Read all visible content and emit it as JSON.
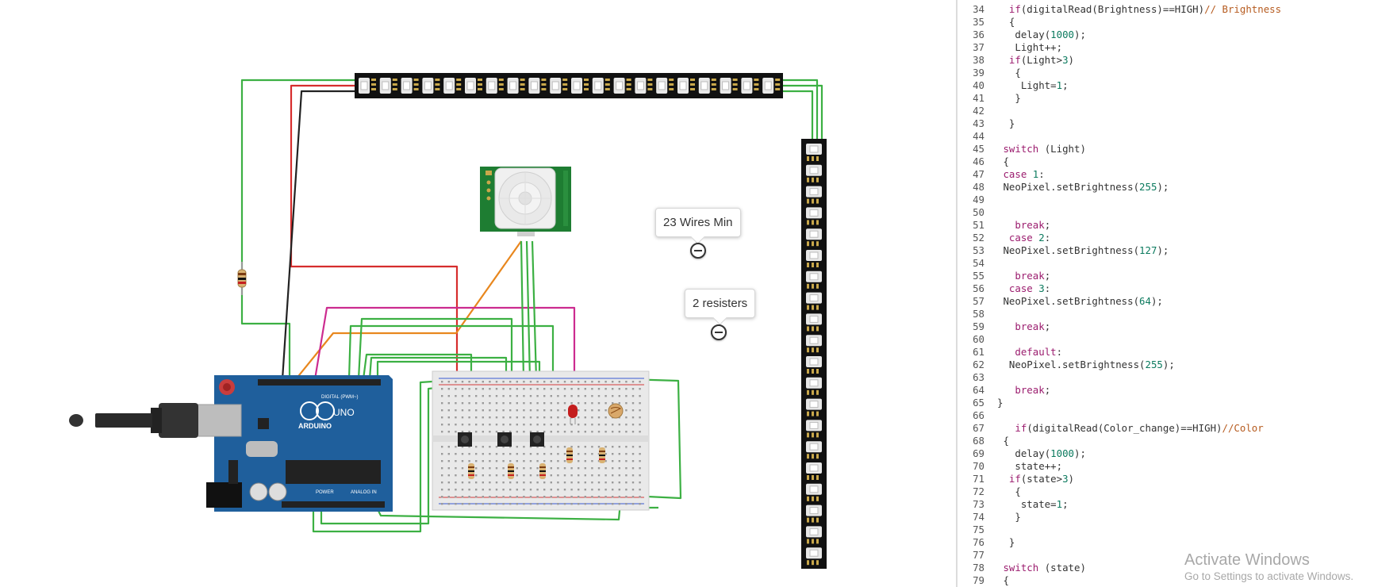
{
  "annotations": [
    {
      "text": "23 Wires Min"
    },
    {
      "text": "2 resisters"
    }
  ],
  "arduino": {
    "brand": "ARDUINO",
    "model": "UNO",
    "digital_label": "DIGITAL (PWM~)",
    "power_label": "POWER",
    "analog_label": "ANALOG IN"
  },
  "code_lines": [
    {
      "n": "34",
      "t": [
        [
          "ind",
          "  "
        ],
        [
          "kw",
          "if"
        ],
        [
          "fn",
          "(digitalRead(Brightness)==HIGH)"
        ],
        [
          "cm",
          "// Brightness"
        ]
      ]
    },
    {
      "n": "35",
      "t": [
        [
          "ind",
          "  "
        ],
        [
          "fn",
          "{"
        ]
      ]
    },
    {
      "n": "36",
      "t": [
        [
          "ind",
          "   "
        ],
        [
          "fn",
          "delay("
        ],
        [
          "num",
          "1000"
        ],
        [
          "fn",
          ");"
        ]
      ]
    },
    {
      "n": "37",
      "t": [
        [
          "ind",
          "   "
        ],
        [
          "fn",
          "Light++;"
        ]
      ]
    },
    {
      "n": "38",
      "t": [
        [
          "ind",
          "  "
        ],
        [
          "kw",
          "if"
        ],
        [
          "fn",
          "(Light>"
        ],
        [
          "num",
          "3"
        ],
        [
          "fn",
          ")"
        ]
      ]
    },
    {
      "n": "39",
      "t": [
        [
          "ind",
          "   "
        ],
        [
          "fn",
          "{"
        ]
      ]
    },
    {
      "n": "40",
      "t": [
        [
          "ind",
          "    "
        ],
        [
          "fn",
          "Light="
        ],
        [
          "num",
          "1"
        ],
        [
          "fn",
          ";"
        ]
      ]
    },
    {
      "n": "41",
      "t": [
        [
          "ind",
          "   "
        ],
        [
          "fn",
          "}"
        ]
      ]
    },
    {
      "n": "42",
      "t": []
    },
    {
      "n": "43",
      "t": [
        [
          "ind",
          "  "
        ],
        [
          "fn",
          "}"
        ]
      ]
    },
    {
      "n": "44",
      "t": []
    },
    {
      "n": "45",
      "t": [
        [
          "ind",
          " "
        ],
        [
          "kw",
          "switch"
        ],
        [
          "fn",
          " (Light)"
        ]
      ]
    },
    {
      "n": "46",
      "t": [
        [
          "ind",
          " "
        ],
        [
          "fn",
          "{"
        ]
      ]
    },
    {
      "n": "47",
      "t": [
        [
          "ind",
          " "
        ],
        [
          "kw",
          "case"
        ],
        [
          "fn",
          " "
        ],
        [
          "num",
          "1"
        ],
        [
          "fn",
          ":"
        ]
      ]
    },
    {
      "n": "48",
      "t": [
        [
          "ind",
          " "
        ],
        [
          "fn",
          "NeoPixel.setBrightness("
        ],
        [
          "num",
          "255"
        ],
        [
          "fn",
          ");"
        ]
      ]
    },
    {
      "n": "49",
      "t": []
    },
    {
      "n": "50",
      "t": []
    },
    {
      "n": "51",
      "t": [
        [
          "ind",
          "   "
        ],
        [
          "kw",
          "break"
        ],
        [
          "fn",
          ";"
        ]
      ]
    },
    {
      "n": "52",
      "t": [
        [
          "ind",
          "  "
        ],
        [
          "kw",
          "case"
        ],
        [
          "fn",
          " "
        ],
        [
          "num",
          "2"
        ],
        [
          "fn",
          ":"
        ]
      ]
    },
    {
      "n": "53",
      "t": [
        [
          "ind",
          " "
        ],
        [
          "fn",
          "NeoPixel.setBrightness("
        ],
        [
          "num",
          "127"
        ],
        [
          "fn",
          ");"
        ]
      ]
    },
    {
      "n": "54",
      "t": []
    },
    {
      "n": "55",
      "t": [
        [
          "ind",
          "   "
        ],
        [
          "kw",
          "break"
        ],
        [
          "fn",
          ";"
        ]
      ]
    },
    {
      "n": "56",
      "t": [
        [
          "ind",
          "  "
        ],
        [
          "kw",
          "case"
        ],
        [
          "fn",
          " "
        ],
        [
          "num",
          "3"
        ],
        [
          "fn",
          ":"
        ]
      ]
    },
    {
      "n": "57",
      "t": [
        [
          "ind",
          " "
        ],
        [
          "fn",
          "NeoPixel.setBrightness("
        ],
        [
          "num",
          "64"
        ],
        [
          "fn",
          ");"
        ]
      ]
    },
    {
      "n": "58",
      "t": []
    },
    {
      "n": "59",
      "t": [
        [
          "ind",
          "   "
        ],
        [
          "kw",
          "break"
        ],
        [
          "fn",
          ";"
        ]
      ]
    },
    {
      "n": "60",
      "t": []
    },
    {
      "n": "61",
      "t": [
        [
          "ind",
          "   "
        ],
        [
          "kw",
          "default"
        ],
        [
          "fn",
          ":"
        ]
      ]
    },
    {
      "n": "62",
      "t": [
        [
          "ind",
          "  "
        ],
        [
          "fn",
          "NeoPixel.setBrightness("
        ],
        [
          "num",
          "255"
        ],
        [
          "fn",
          ");"
        ]
      ]
    },
    {
      "n": "63",
      "t": []
    },
    {
      "n": "64",
      "t": [
        [
          "ind",
          "   "
        ],
        [
          "kw",
          "break"
        ],
        [
          "fn",
          ";"
        ]
      ]
    },
    {
      "n": "65",
      "t": [
        [
          "fn",
          "}"
        ]
      ]
    },
    {
      "n": "66",
      "t": []
    },
    {
      "n": "67",
      "t": [
        [
          "ind",
          "   "
        ],
        [
          "kw",
          "if"
        ],
        [
          "fn",
          "(digitalRead(Color_change)==HIGH)"
        ],
        [
          "cm",
          "//Color"
        ]
      ]
    },
    {
      "n": "68",
      "t": [
        [
          "ind",
          " "
        ],
        [
          "fn",
          "{"
        ]
      ]
    },
    {
      "n": "69",
      "t": [
        [
          "ind",
          "   "
        ],
        [
          "fn",
          "delay("
        ],
        [
          "num",
          "1000"
        ],
        [
          "fn",
          ");"
        ]
      ]
    },
    {
      "n": "70",
      "t": [
        [
          "ind",
          "   "
        ],
        [
          "fn",
          "state++;"
        ]
      ]
    },
    {
      "n": "71",
      "t": [
        [
          "ind",
          "  "
        ],
        [
          "kw",
          "if"
        ],
        [
          "fn",
          "(state>"
        ],
        [
          "num",
          "3"
        ],
        [
          "fn",
          ")"
        ]
      ]
    },
    {
      "n": "72",
      "t": [
        [
          "ind",
          "   "
        ],
        [
          "fn",
          "{"
        ]
      ]
    },
    {
      "n": "73",
      "t": [
        [
          "ind",
          "    "
        ],
        [
          "fn",
          "state="
        ],
        [
          "num",
          "1"
        ],
        [
          "fn",
          ";"
        ]
      ]
    },
    {
      "n": "74",
      "t": [
        [
          "ind",
          "   "
        ],
        [
          "fn",
          "}"
        ]
      ]
    },
    {
      "n": "75",
      "t": []
    },
    {
      "n": "76",
      "t": [
        [
          "ind",
          "  "
        ],
        [
          "fn",
          "}"
        ]
      ]
    },
    {
      "n": "77",
      "t": []
    },
    {
      "n": "78",
      "t": [
        [
          "ind",
          " "
        ],
        [
          "kw",
          "switch"
        ],
        [
          "fn",
          " (state)"
        ]
      ]
    },
    {
      "n": "79",
      "t": [
        [
          "ind",
          " "
        ],
        [
          "fn",
          "{"
        ]
      ]
    }
  ],
  "watermark": {
    "title": "Activate Windows",
    "subtitle": "Go to Settings to activate Windows."
  },
  "colors": {
    "wire_green": "#3cb043",
    "wire_red": "#d62d2d",
    "wire_black": "#222222",
    "wire_orange": "#e8871e",
    "wire_magenta": "#cc2b8f",
    "board_blue": "#1f5f9c",
    "pir_green": "#1e7d32",
    "strip_black": "#111111",
    "breadboard": "#e9e9e9"
  }
}
